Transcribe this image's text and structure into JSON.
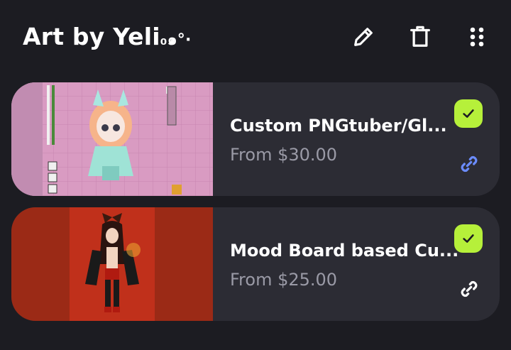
{
  "header": {
    "title": "Art by Yeli",
    "title_decoration": "₀๑°·",
    "icons": [
      "edit-icon",
      "trash-icon",
      "more-grid-icon"
    ]
  },
  "colors": {
    "background": "#1c1c22",
    "card": "#2c2c34",
    "check_green": "#b6f03a",
    "link_blue": "#6b8cff",
    "price_gray": "#9a9aa6"
  },
  "products": [
    {
      "title": "Custom PNGtuber/Gl...",
      "price": "From $30.00",
      "checked": true,
      "link_icon": "link-icon"
    },
    {
      "title": "Mood Board based Cu...",
      "price": "From $25.00",
      "checked": true,
      "link_icon": "link-icon"
    }
  ]
}
